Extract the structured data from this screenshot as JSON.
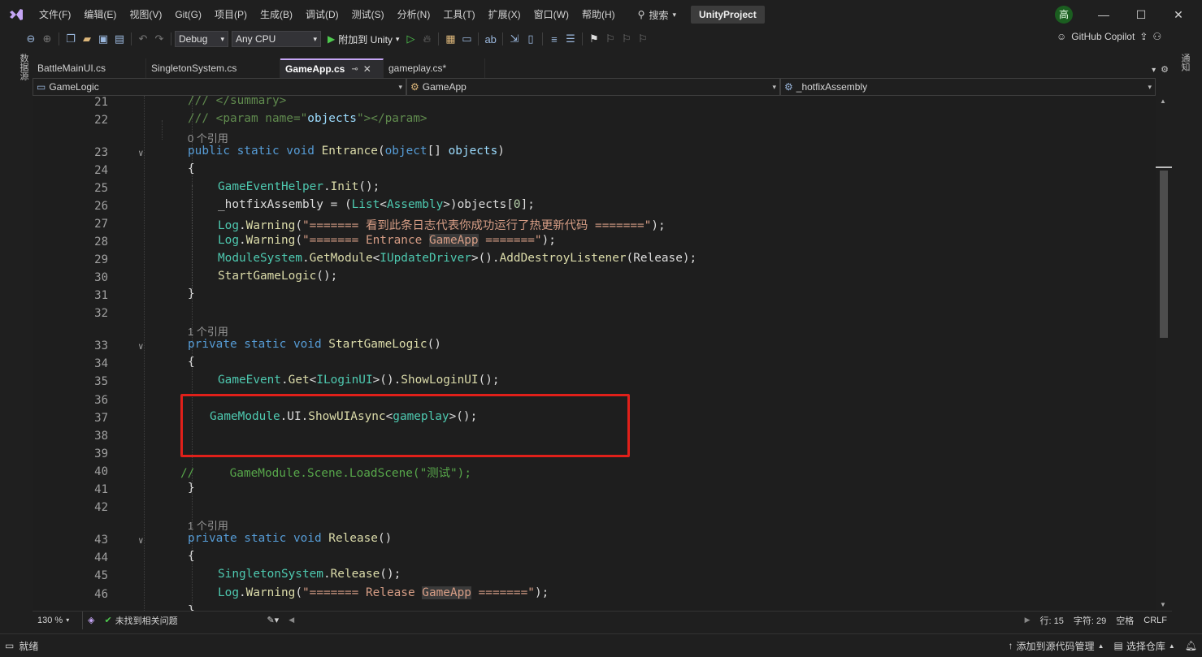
{
  "menubar": {
    "logo": "VS",
    "items": [
      "文件(F)",
      "编辑(E)",
      "视图(V)",
      "Git(G)",
      "项目(P)",
      "生成(B)",
      "调试(D)",
      "测试(S)",
      "分析(N)",
      "工具(T)",
      "扩展(X)",
      "窗口(W)",
      "帮助(H)"
    ],
    "search_label": "搜索",
    "project_name": "UnityProject",
    "avatar_text": "高",
    "minimize": "—",
    "maximize": "☐",
    "close": "✕"
  },
  "toolbar": {
    "config": "Debug",
    "platform": "Any CPU",
    "run_label": "附加到 Unity",
    "copilot_label": "GitHub Copilot"
  },
  "side": {
    "left_tab": "数据源",
    "right_tab": "通知"
  },
  "tabs": [
    {
      "label": "BattleMainUI.cs"
    },
    {
      "label": "SingletonSystem.cs"
    },
    {
      "label": "GameApp.cs"
    },
    {
      "label": "gameplay.cs*"
    }
  ],
  "nav": {
    "project": "GameLogic",
    "class": "GameApp",
    "member": "_hotfixAssembly"
  },
  "code_lines": [
    {
      "n": "21"
    },
    {
      "n": "22"
    },
    {
      "n": "23"
    },
    {
      "n": "24"
    },
    {
      "n": "25"
    },
    {
      "n": "26"
    },
    {
      "n": "27"
    },
    {
      "n": "28"
    },
    {
      "n": "29"
    },
    {
      "n": "30"
    },
    {
      "n": "31"
    },
    {
      "n": "32"
    },
    {
      "n": "33"
    },
    {
      "n": "34"
    },
    {
      "n": "35"
    },
    {
      "n": "36"
    },
    {
      "n": "37"
    },
    {
      "n": "38"
    },
    {
      "n": "39"
    },
    {
      "n": "40"
    },
    {
      "n": "41"
    },
    {
      "n": "42"
    },
    {
      "n": "43"
    },
    {
      "n": "44"
    },
    {
      "n": "45"
    },
    {
      "n": "46"
    }
  ],
  "code": {
    "l21": "/// </summary>",
    "l22a": "/// <param name=\"",
    "l22b": "objects",
    "l22c": "\"></param>",
    "lens1": "0 个引用",
    "l23_kw": "public static void",
    "l23_fn": "Entrance",
    "l23_a": "(",
    "l23_kw2": "object",
    "l23_b": "[] ",
    "l23_p": "objects",
    "l23_c": ")",
    "l24": "{",
    "l25_ty": "GameEventHelper",
    "l25_a": ".",
    "l25_fn": "Init",
    "l25_b": "();",
    "l26_a": "_hotfixAssembly = (",
    "l26_ty1": "List",
    "l26_b": "<",
    "l26_ty2": "Assembly",
    "l26_c": ">)objects[",
    "l26_num": "0",
    "l26_d": "];",
    "l27_ty": "Log",
    "l27_a": ".",
    "l27_fn": "Warning",
    "l27_b": "(",
    "l27_str": "\"======= 看到此条日志代表你成功运行了热更新代码 =======\"",
    "l27_c": ");",
    "l28_ty": "Log",
    "l28_a": ".",
    "l28_fn": "Warning",
    "l28_b": "(",
    "l28_str1": "\"======= Entrance ",
    "l28_hl": "GameApp",
    "l28_str2": " =======\"",
    "l28_c": ");",
    "l29_ty1": "ModuleSystem",
    "l29_a": ".",
    "l29_fn1": "GetModule",
    "l29_b": "<",
    "l29_ty2": "IUpdateDriver",
    "l29_c": ">().",
    "l29_fn2": "AddDestroyListener",
    "l29_d": "(Release);",
    "l30_fn": "StartGameLogic",
    "l30_a": "();",
    "l31": "}",
    "lens2": "1 个引用",
    "l33_kw": "private static void",
    "l33_fn": "StartGameLogic",
    "l33_a": "()",
    "l34": "{",
    "l35_ty1": "GameEvent",
    "l35_a": ".",
    "l35_fn1": "Get",
    "l35_b": "<",
    "l35_ty2": "ILoginUI",
    "l35_c": ">().",
    "l35_fn2": "ShowLoginUI",
    "l35_d": "();",
    "l37_ty": "GameModule",
    "l37_a": ".UI.",
    "l37_fn": "ShowUIAsync",
    "l37_b": "<",
    "l37_ty2": "gameplay",
    "l37_c": ">();",
    "l40": "//     GameModule.Scene.LoadScene(\"测试\");",
    "l41": "}",
    "lens3": "1 个引用",
    "l43_kw": "private static void",
    "l43_fn": "Release",
    "l43_a": "()",
    "l44": "{",
    "l45_ty": "SingletonSystem",
    "l45_a": ".",
    "l45_fn": "Release",
    "l45_b": "();",
    "l46_ty": "Log",
    "l46_a": ".",
    "l46_fn": "Warning",
    "l46_b": "(",
    "l46_str1": "\"======= Release ",
    "l46_hl": "GameApp",
    "l46_str2": " =======\"",
    "l46_c": ");",
    "l47": "}"
  },
  "editor_status": {
    "zoom": "130 %",
    "issues": "未找到相关问题",
    "line": "行: 15",
    "char": "字符: 29",
    "spaces": "空格",
    "eol": "CRLF"
  },
  "statusbar": {
    "ready": "就绪",
    "add_source": "添加到源代码管理",
    "select_repo": "选择仓库"
  }
}
